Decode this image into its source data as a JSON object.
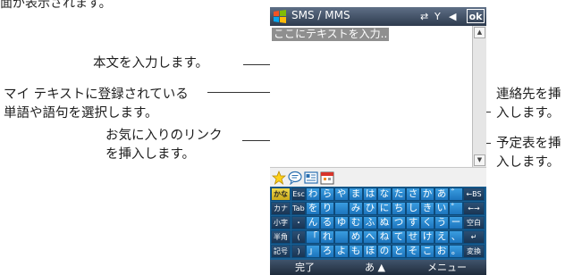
{
  "top_caption": "面が表示されます。",
  "callouts": {
    "body_input": "本文を入力します。",
    "my_text_line1": "マイ テキストに登録されている",
    "my_text_line2": "単語や語句を選択します。",
    "favorites_line1": "お気に入りのリンク",
    "favorites_line2": "を挿入します。",
    "contact_line1": "連絡先を挿",
    "contact_line2": "入します。",
    "calendar_line1": "予定表を挿",
    "calendar_line2": "入します。"
  },
  "device": {
    "title": "SMS / MMS",
    "ok_label": "ok",
    "message_placeholder": "ここにテキストを入力..",
    "status_icons": [
      "connectivity-icon",
      "signal-icon",
      "speaker-icon"
    ],
    "toolbar_icons": [
      "favorites-star-icon",
      "my-text-icon",
      "contact-card-icon",
      "calendar-icon"
    ],
    "keyboard": {
      "side_keys": [
        "かな",
        "カナ",
        "小字",
        "半角",
        "記号"
      ],
      "rows": [
        [
          "Esc",
          "わ",
          "ら",
          "や",
          "ま",
          "は",
          "な",
          "た",
          "さ",
          "か",
          "あ",
          "゛",
          "←BS"
        ],
        [
          "Tab",
          "を",
          "り",
          "",
          "み",
          "ひ",
          "に",
          "ち",
          "し",
          "き",
          "い",
          "゜",
          "←→"
        ],
        [
          "・",
          "ん",
          "る",
          "ゆ",
          "む",
          "ふ",
          "ぬ",
          "つ",
          "す",
          "く",
          "う",
          "ー",
          "空白"
        ],
        [
          "(",
          "「",
          "れ",
          "",
          "め",
          "へ",
          "ね",
          "て",
          "せ",
          "け",
          "え",
          "、",
          "↵"
        ],
        [
          ")",
          "」",
          "ろ",
          "よ",
          "も",
          "ほ",
          "の",
          "と",
          "そ",
          "こ",
          "お",
          "。",
          "変換"
        ]
      ]
    },
    "menu": {
      "left": "完了",
      "center": "あ ▲",
      "right": "メニュー"
    }
  },
  "colors": {
    "keyboard_key": "#2a87cf",
    "title_bar": "#3b4a60",
    "kana_key": "#e3c73a"
  }
}
